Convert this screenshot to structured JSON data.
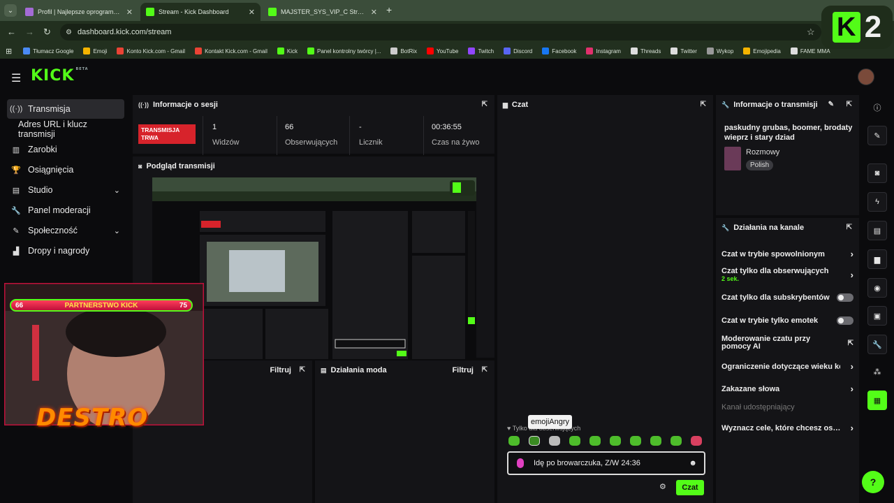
{
  "browser": {
    "tabs": [
      {
        "title": "Profil | Najlepsze oprogramowanie do",
        "color": "#a46bd6"
      },
      {
        "title": "Stream - Kick Dashboard",
        "color": "#53fc18"
      },
      {
        "title": "MAJSTER_SYS_VIP_C Stream - Watch",
        "color": "#53fc18"
      }
    ],
    "url": "dashboard.kick.com/stream",
    "bookmarks": [
      {
        "label": "Tłumacz Google",
        "color": "#4a8af4"
      },
      {
        "label": "Emoji",
        "color": "#f4b400"
      },
      {
        "label": "Konto Kick.com - Gmail",
        "color": "#ea4335"
      },
      {
        "label": "Kontakt Kick.com - Gmail",
        "color": "#ea4335"
      },
      {
        "label": "Kick",
        "color": "#53fc18"
      },
      {
        "label": "Panel kontrolny twórcy |...",
        "color": "#53fc18"
      },
      {
        "label": "BotRix",
        "color": "#cccccc"
      },
      {
        "label": "YouTube",
        "color": "#ff0000"
      },
      {
        "label": "Twitch",
        "color": "#9146ff"
      },
      {
        "label": "Discord",
        "color": "#5865f2"
      },
      {
        "label": "Facebook",
        "color": "#1877f2"
      },
      {
        "label": "Instagram",
        "color": "#e1306c"
      },
      {
        "label": "Threads",
        "color": "#dddddd"
      },
      {
        "label": "Twitter",
        "color": "#dddddd"
      },
      {
        "label": "Wykop",
        "color": "#999999"
      },
      {
        "label": "Emojipedia",
        "color": "#f4b400"
      },
      {
        "label": "FAME MMA",
        "color": "#dddddd"
      }
    ],
    "logo_text": "2"
  },
  "header": {
    "logo": "KICK",
    "beta": "BETA"
  },
  "sidebar": {
    "items": [
      {
        "label": "Transmisja",
        "icon": "broadcast-icon"
      },
      {
        "label": "Adres URL i klucz transmisji",
        "icon": ""
      },
      {
        "label": "Zarobki",
        "icon": "chart-icon"
      },
      {
        "label": "Osiągnięcia",
        "icon": "trophy-icon"
      },
      {
        "label": "Studio",
        "icon": "studio-icon"
      },
      {
        "label": "Panel moderacji",
        "icon": "wrench-icon"
      },
      {
        "label": "Społeczność",
        "icon": "community-icon"
      },
      {
        "label": "Dropy i nagrody",
        "icon": "drops-icon"
      }
    ]
  },
  "session": {
    "title": "Informacje o sesji",
    "status": "TRANSMISJA TRWA",
    "stats": [
      {
        "value": "1",
        "label": "Widzów"
      },
      {
        "value": "66",
        "label": "Obserwujących"
      },
      {
        "value": "-",
        "label": "Licznik subskrypcji"
      },
      {
        "value": "00:36:55",
        "label": "Czas na żywo"
      }
    ]
  },
  "preview": {
    "title": "Podgląd transmisji"
  },
  "chat": {
    "title": "Czat",
    "emotes_only": "Tylko dla obserwujących",
    "tooltip": "emojiAngry",
    "input_value": "Idę po browarczuka, Z/W 24:36",
    "send_label": "Czat"
  },
  "stream_info": {
    "title": "Informacje o transmisji",
    "stream_title": "paskudny grubas, boomer, brodaty wieprz i stary dziad",
    "category": "Rozmowy",
    "language": "Polish"
  },
  "channel_actions": {
    "title": "Działania na kanale",
    "rows": [
      {
        "label": "Czat w trybie spowolnionym",
        "control": "chevron"
      },
      {
        "label": "Czat tylko dla obserwujących",
        "sub": "2 sek.",
        "control": "chevron"
      },
      {
        "label": "Czat tylko dla subskrybentów",
        "control": "toggle"
      },
      {
        "label": "Czat w trybie tylko emotek",
        "control": "toggle"
      },
      {
        "label": "Moderowanie czatu przy pomocy AI",
        "control": "external"
      },
      {
        "label": "Ograniczenie dotyczące wieku konta",
        "control": "chevron"
      },
      {
        "label": "Zakazane słowa",
        "control": "chevron"
      },
      {
        "label": "Kanał udostępniający",
        "control": "none"
      },
      {
        "label": "Wyznacz cele, które chcesz osiągnąć",
        "control": "chevron"
      }
    ]
  },
  "bottom_panels": {
    "left": {
      "filter": "Filtruj"
    },
    "mod": {
      "title": "Działania moda",
      "filter": "Filtruj"
    }
  },
  "overlay": {
    "bar_left": "66",
    "bar_label": "PARTNERSTWO KICK",
    "bar_right": "75",
    "name": "DESTRO"
  },
  "colors": {
    "accent": "#53fc18",
    "live": "#d7232b",
    "panel": "#141417"
  }
}
